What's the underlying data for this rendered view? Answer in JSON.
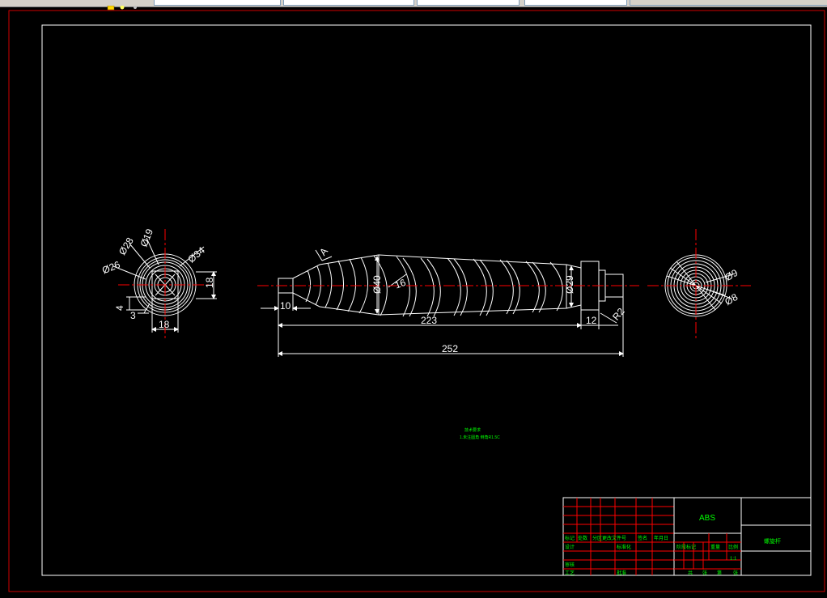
{
  "toolbar": {
    "icons": [
      "layer-icon",
      "lightbulb-icon",
      "sun-icon"
    ],
    "fields": [
      "",
      "",
      "",
      "",
      ""
    ]
  },
  "drawing": {
    "background": "#000000",
    "line_color": "#ffffff",
    "border_color": "#ff0000",
    "center_line_color": "#ff0000",
    "dimension_color": "#ffffff",
    "text_color": "#00ff00"
  },
  "dimensions": {
    "left_view": {
      "d28": "Ø28",
      "d19": "Ø19",
      "d34": "Ø34",
      "d26": "Ø26",
      "h18": "18",
      "dim4": "4",
      "dim3": "3",
      "w18": "18"
    },
    "front_view": {
      "a": "A",
      "d40": "Ø40",
      "pitch16": "16",
      "d29": "Ø29",
      "len10": "10",
      "len223": "223",
      "len12": "12",
      "r2": "R2",
      "len252": "252"
    },
    "right_view": {
      "d9": "Ø9",
      "d8": "Ø8"
    }
  },
  "notes": {
    "title": "技术要求",
    "line1": "1.未注圆角 倒角R1.5C"
  },
  "title_block": {
    "material": "ABS",
    "part_name": "螺旋杆",
    "row_labels": [
      "标记",
      "处数",
      "分区",
      "更改文件号",
      "签名",
      "年月日"
    ],
    "design": "设计",
    "standard": "标准化",
    "review": "审核",
    "process": "工艺",
    "approve": "批准",
    "stage_mark": "阶段标记",
    "weight": "重量",
    "scale": "比例",
    "scale_value": "1:1",
    "sheets": "共",
    "sheet_of": "张",
    "sheet_no": "第",
    "sheet_no_end": "张"
  }
}
